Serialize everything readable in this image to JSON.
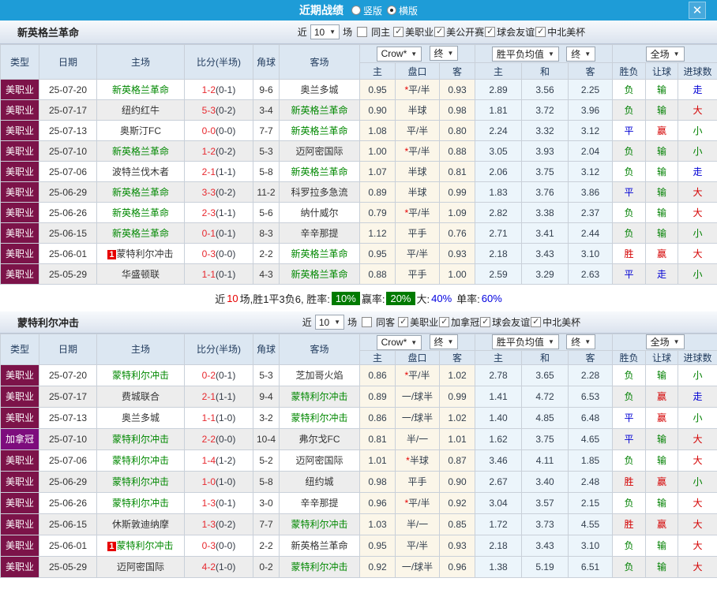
{
  "colors": {
    "accent_blue": "#1e9cd7",
    "type_mls": "#7c1349",
    "type_cup": "#7d0c7d",
    "team_highlight": "#008800",
    "score_red": "#e7282e",
    "badge_green": "#007a00"
  },
  "result_colors": {
    "胜": "#d40000",
    "平": "#0000d4",
    "负": "#008000",
    "赢": "#d40000",
    "走": "#0000d4",
    "输": "#008000",
    "大": "#d40000",
    "小": "#008000"
  },
  "title_bar": {
    "title": "近期战绩",
    "close_icon": "✕",
    "options": [
      {
        "label": "竖版",
        "selected": false
      },
      {
        "label": "横版",
        "selected": true
      }
    ]
  },
  "table_header": {
    "type": "类型",
    "date": "日期",
    "home": "主场",
    "score": "比分(半场)",
    "corner": "角球",
    "away": "客场",
    "dd_company": "Crow*",
    "dd_final1": "终",
    "dd_wdl": "胜平负均值",
    "dd_final2": "终",
    "dd_scope": "全场",
    "sub": [
      "主",
      "盘口",
      "客",
      "主",
      "和",
      "客",
      "胜负",
      "让球",
      "进球数"
    ]
  },
  "sections": [
    {
      "team": "新英格兰革命",
      "filters": {
        "near": "近",
        "count": "10",
        "games": "场",
        "same": {
          "label": "同主",
          "checked": false
        },
        "leagues": [
          {
            "label": "美职业",
            "checked": true
          },
          {
            "label": "美公开赛",
            "checked": true
          },
          {
            "label": "球会友谊",
            "checked": true
          },
          {
            "label": "中北美杯",
            "checked": true
          }
        ]
      },
      "rows": [
        {
          "type": "美职业",
          "type_style": "mls",
          "date": "25-07-20",
          "home": "新英格兰革命",
          "home_hl": true,
          "home_badge": "",
          "score": "1-2",
          "half": "(0-1)",
          "corner": "9-6",
          "away": "奥兰多城",
          "away_hl": false,
          "away_badge": "",
          "handicap": [
            "0.95",
            "*平/半",
            "0.93"
          ],
          "odds1x2": [
            "2.89",
            "3.56",
            "2.25"
          ],
          "results": [
            "负",
            "输",
            "走"
          ]
        },
        {
          "type": "美职业",
          "type_style": "mls",
          "date": "25-07-17",
          "home": "纽约红牛",
          "home_hl": false,
          "home_badge": "",
          "score": "5-3",
          "half": "(0-2)",
          "corner": "3-4",
          "away": "新英格兰革命",
          "away_hl": true,
          "away_badge": "",
          "handicap": [
            "0.90",
            "半球",
            "0.98"
          ],
          "odds1x2": [
            "1.81",
            "3.72",
            "3.96"
          ],
          "results": [
            "负",
            "输",
            "大"
          ]
        },
        {
          "type": "美职业",
          "type_style": "mls",
          "date": "25-07-13",
          "home": "奥斯汀FC",
          "home_hl": false,
          "home_badge": "",
          "score": "0-0",
          "half": "(0-0)",
          "corner": "7-7",
          "away": "新英格兰革命",
          "away_hl": true,
          "away_badge": "",
          "handicap": [
            "1.08",
            "平/半",
            "0.80"
          ],
          "odds1x2": [
            "2.24",
            "3.32",
            "3.12"
          ],
          "results": [
            "平",
            "赢",
            "小"
          ]
        },
        {
          "type": "美职业",
          "type_style": "mls",
          "date": "25-07-10",
          "home": "新英格兰革命",
          "home_hl": true,
          "home_badge": "",
          "score": "1-2",
          "half": "(0-2)",
          "corner": "5-3",
          "away": "迈阿密国际",
          "away_hl": false,
          "away_badge": "",
          "handicap": [
            "1.00",
            "*平/半",
            "0.88"
          ],
          "odds1x2": [
            "3.05",
            "3.93",
            "2.04"
          ],
          "results": [
            "负",
            "输",
            "小"
          ]
        },
        {
          "type": "美职业",
          "type_style": "mls",
          "date": "25-07-06",
          "home": "波特兰伐木者",
          "home_hl": false,
          "home_badge": "",
          "score": "2-1",
          "half": "(1-1)",
          "corner": "5-8",
          "away": "新英格兰革命",
          "away_hl": true,
          "away_badge": "",
          "handicap": [
            "1.07",
            "半球",
            "0.81"
          ],
          "odds1x2": [
            "2.06",
            "3.75",
            "3.12"
          ],
          "results": [
            "负",
            "输",
            "走"
          ]
        },
        {
          "type": "美职业",
          "type_style": "mls",
          "date": "25-06-29",
          "home": "新英格兰革命",
          "home_hl": true,
          "home_badge": "",
          "score": "3-3",
          "half": "(0-2)",
          "corner": "11-2",
          "away": "科罗拉多急流",
          "away_hl": false,
          "away_badge": "",
          "handicap": [
            "0.89",
            "半球",
            "0.99"
          ],
          "odds1x2": [
            "1.83",
            "3.76",
            "3.86"
          ],
          "results": [
            "平",
            "输",
            "大"
          ]
        },
        {
          "type": "美职业",
          "type_style": "mls",
          "date": "25-06-26",
          "home": "新英格兰革命",
          "home_hl": true,
          "home_badge": "",
          "score": "2-3",
          "half": "(1-1)",
          "corner": "5-6",
          "away": "纳什威尔",
          "away_hl": false,
          "away_badge": "",
          "handicap": [
            "0.79",
            "*平/半",
            "1.09"
          ],
          "odds1x2": [
            "2.82",
            "3.38",
            "2.37"
          ],
          "results": [
            "负",
            "输",
            "大"
          ]
        },
        {
          "type": "美职业",
          "type_style": "mls",
          "date": "25-06-15",
          "home": "新英格兰革命",
          "home_hl": true,
          "home_badge": "",
          "score": "0-1",
          "half": "(0-1)",
          "corner": "8-3",
          "away": "辛辛那提",
          "away_hl": false,
          "away_badge": "",
          "handicap": [
            "1.12",
            "平手",
            "0.76"
          ],
          "odds1x2": [
            "2.71",
            "3.41",
            "2.44"
          ],
          "results": [
            "负",
            "输",
            "小"
          ]
        },
        {
          "type": "美职业",
          "type_style": "mls",
          "date": "25-06-01",
          "home": "蒙特利尔冲击",
          "home_hl": false,
          "home_badge": "1",
          "score": "0-3",
          "half": "(0-0)",
          "corner": "2-2",
          "away": "新英格兰革命",
          "away_hl": true,
          "away_badge": "",
          "handicap": [
            "0.95",
            "平/半",
            "0.93"
          ],
          "odds1x2": [
            "2.18",
            "3.43",
            "3.10"
          ],
          "results": [
            "胜",
            "赢",
            "大"
          ]
        },
        {
          "type": "美职业",
          "type_style": "mls",
          "date": "25-05-29",
          "home": "华盛顿联",
          "home_hl": false,
          "home_badge": "",
          "score": "1-1",
          "half": "(0-1)",
          "corner": "4-3",
          "away": "新英格兰革命",
          "away_hl": true,
          "away_badge": "",
          "handicap": [
            "0.88",
            "平手",
            "1.00"
          ],
          "odds1x2": [
            "2.59",
            "3.29",
            "2.63"
          ],
          "results": [
            "平",
            "走",
            "小"
          ]
        }
      ],
      "summary": {
        "near": "近",
        "count": "10",
        "mid": "场,胜1平3负6, 胜率:",
        "win_rate": "10%",
        "label_cover": "赢率:",
        "cover_rate": "20%",
        "label_big": "大:",
        "big_rate": "40%",
        "label_single": "单率:",
        "single_rate": "60%"
      }
    },
    {
      "team": "蒙特利尔冲击",
      "filters": {
        "near": "近",
        "count": "10",
        "games": "场",
        "same": {
          "label": "同客",
          "checked": false
        },
        "leagues": [
          {
            "label": "美职业",
            "checked": true
          },
          {
            "label": "加拿冠",
            "checked": true
          },
          {
            "label": "球会友谊",
            "checked": true
          },
          {
            "label": "中北美杯",
            "checked": true
          }
        ]
      },
      "rows": [
        {
          "type": "美职业",
          "type_style": "mls",
          "date": "25-07-20",
          "home": "蒙特利尔冲击",
          "home_hl": true,
          "home_badge": "",
          "score": "0-2",
          "half": "(0-1)",
          "corner": "5-3",
          "away": "芝加哥火焰",
          "away_hl": false,
          "away_badge": "",
          "handicap": [
            "0.86",
            "*平/半",
            "1.02"
          ],
          "odds1x2": [
            "2.78",
            "3.65",
            "2.28"
          ],
          "results": [
            "负",
            "输",
            "小"
          ]
        },
        {
          "type": "美职业",
          "type_style": "mls",
          "date": "25-07-17",
          "home": "费城联合",
          "home_hl": false,
          "home_badge": "",
          "score": "2-1",
          "half": "(1-1)",
          "corner": "9-4",
          "away": "蒙特利尔冲击",
          "away_hl": true,
          "away_badge": "",
          "handicap": [
            "0.89",
            "一/球半",
            "0.99"
          ],
          "odds1x2": [
            "1.41",
            "4.72",
            "6.53"
          ],
          "results": [
            "负",
            "赢",
            "走"
          ]
        },
        {
          "type": "美职业",
          "type_style": "mls",
          "date": "25-07-13",
          "home": "奥兰多城",
          "home_hl": false,
          "home_badge": "",
          "score": "1-1",
          "half": "(1-0)",
          "corner": "3-2",
          "away": "蒙特利尔冲击",
          "away_hl": true,
          "away_badge": "",
          "handicap": [
            "0.86",
            "一/球半",
            "1.02"
          ],
          "odds1x2": [
            "1.40",
            "4.85",
            "6.48"
          ],
          "results": [
            "平",
            "赢",
            "小"
          ]
        },
        {
          "type": "加拿冠",
          "type_style": "cup",
          "date": "25-07-10",
          "home": "蒙特利尔冲击",
          "home_hl": true,
          "home_badge": "",
          "score": "2-2",
          "half": "(0-0)",
          "corner": "10-4",
          "away": "弗尔戈FC",
          "away_hl": false,
          "away_badge": "",
          "handicap": [
            "0.81",
            "半/一",
            "1.01"
          ],
          "odds1x2": [
            "1.62",
            "3.75",
            "4.65"
          ],
          "results": [
            "平",
            "输",
            "大"
          ]
        },
        {
          "type": "美职业",
          "type_style": "mls",
          "date": "25-07-06",
          "home": "蒙特利尔冲击",
          "home_hl": true,
          "home_badge": "",
          "score": "1-4",
          "half": "(1-2)",
          "corner": "5-2",
          "away": "迈阿密国际",
          "away_hl": false,
          "away_badge": "",
          "handicap": [
            "1.01",
            "*半球",
            "0.87"
          ],
          "odds1x2": [
            "3.46",
            "4.11",
            "1.85"
          ],
          "results": [
            "负",
            "输",
            "大"
          ]
        },
        {
          "type": "美职业",
          "type_style": "mls",
          "date": "25-06-29",
          "home": "蒙特利尔冲击",
          "home_hl": true,
          "home_badge": "",
          "score": "1-0",
          "half": "(1-0)",
          "corner": "5-8",
          "away": "纽约城",
          "away_hl": false,
          "away_badge": "",
          "handicap": [
            "0.98",
            "平手",
            "0.90"
          ],
          "odds1x2": [
            "2.67",
            "3.40",
            "2.48"
          ],
          "results": [
            "胜",
            "赢",
            "小"
          ]
        },
        {
          "type": "美职业",
          "type_style": "mls",
          "date": "25-06-26",
          "home": "蒙特利尔冲击",
          "home_hl": true,
          "home_badge": "",
          "score": "1-3",
          "half": "(0-1)",
          "corner": "3-0",
          "away": "辛辛那提",
          "away_hl": false,
          "away_badge": "",
          "handicap": [
            "0.96",
            "*平/半",
            "0.92"
          ],
          "odds1x2": [
            "3.04",
            "3.57",
            "2.15"
          ],
          "results": [
            "负",
            "输",
            "大"
          ]
        },
        {
          "type": "美职业",
          "type_style": "mls",
          "date": "25-06-15",
          "home": "休斯敦迪纳摩",
          "home_hl": false,
          "home_badge": "",
          "score": "1-3",
          "half": "(0-2)",
          "corner": "7-7",
          "away": "蒙特利尔冲击",
          "away_hl": true,
          "away_badge": "",
          "handicap": [
            "1.03",
            "半/一",
            "0.85"
          ],
          "odds1x2": [
            "1.72",
            "3.73",
            "4.55"
          ],
          "results": [
            "胜",
            "赢",
            "大"
          ]
        },
        {
          "type": "美职业",
          "type_style": "mls",
          "date": "25-06-01",
          "home": "蒙特利尔冲击",
          "home_hl": true,
          "home_badge": "1",
          "score": "0-3",
          "half": "(0-0)",
          "corner": "2-2",
          "away": "新英格兰革命",
          "away_hl": false,
          "away_badge": "",
          "handicap": [
            "0.95",
            "平/半",
            "0.93"
          ],
          "odds1x2": [
            "2.18",
            "3.43",
            "3.10"
          ],
          "results": [
            "负",
            "输",
            "大"
          ]
        },
        {
          "type": "美职业",
          "type_style": "mls",
          "date": "25-05-29",
          "home": "迈阿密国际",
          "home_hl": false,
          "home_badge": "",
          "score": "4-2",
          "half": "(1-0)",
          "corner": "0-2",
          "away": "蒙特利尔冲击",
          "away_hl": true,
          "away_badge": "",
          "handicap": [
            "0.92",
            "一/球半",
            "0.96"
          ],
          "odds1x2": [
            "1.38",
            "5.19",
            "6.51"
          ],
          "results": [
            "负",
            "输",
            "大"
          ]
        }
      ]
    }
  ]
}
